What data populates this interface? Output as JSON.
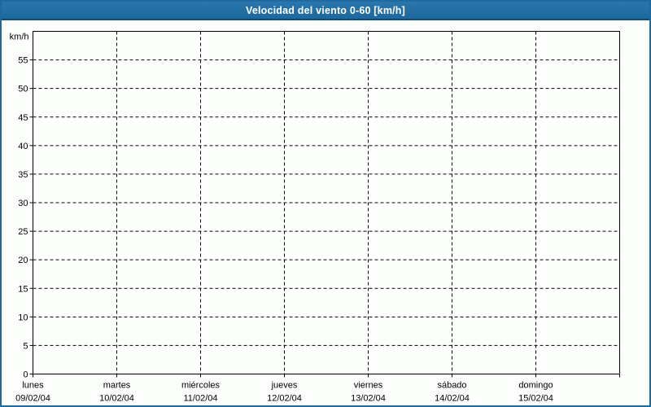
{
  "window": {
    "title": "Velocidad del viento 0-60 [km/h]"
  },
  "colors": {
    "titlebar_top": "#2a77ad",
    "titlebar_bottom": "#1d689d",
    "titlebar_edge": "#0f4c77",
    "window_border": "#1e6a9f",
    "background": "#fcfefc",
    "plot_background": "#fdfffd",
    "axis": "#000000",
    "grid": "#000000",
    "title_text": "#ffffff",
    "label_text": "#000000"
  },
  "chart_data": {
    "type": "line",
    "title": "Velocidad del viento 0-60 [km/h]",
    "ylabel": "km/h",
    "ylim": [
      0,
      60
    ],
    "yticks": [
      0,
      5,
      10,
      15,
      20,
      25,
      30,
      35,
      40,
      45,
      50,
      55
    ],
    "grid": "dashed horizontal lines every 5 km/h and dashed vertical lines at each day boundary",
    "legend": "none",
    "x_categories": [
      {
        "day": "lunes",
        "date": "09/02/04"
      },
      {
        "day": "martes",
        "date": "10/02/04"
      },
      {
        "day": "miércoles",
        "date": "11/02/04"
      },
      {
        "day": "jueves",
        "date": "12/02/04"
      },
      {
        "day": "viernes",
        "date": "13/02/04"
      },
      {
        "day": "sábado",
        "date": "14/02/04"
      },
      {
        "day": "domingo",
        "date": "15/02/04"
      }
    ],
    "series": [],
    "note": "plot area contains no data points"
  }
}
